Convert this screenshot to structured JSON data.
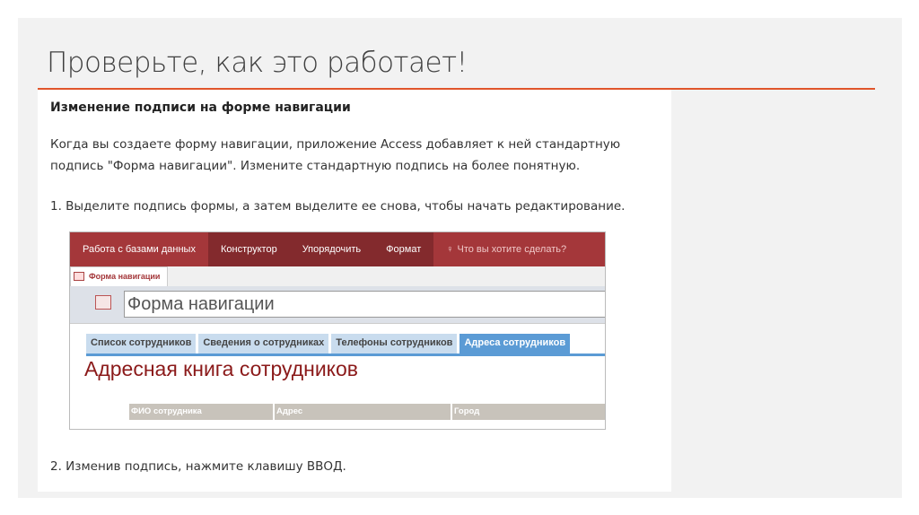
{
  "slide": {
    "title": "Проверьте, как это работает!"
  },
  "content": {
    "heading": "Изменение подписи на форме навигации",
    "paragraph": "Когда вы создаете форму навигации, приложение Access добавляет к ней стандартную подпись \"Форма навигации\". Измените стандартную подпись на более понятную.",
    "step1": "1.  Выделите подпись формы, а затем выделите ее снова, чтобы начать редактирование.",
    "step2": "2.  Изменив подпись, нажмите клавишу ВВОД."
  },
  "screenshot": {
    "ribbon": [
      "Работа с базами данных",
      "Конструктор",
      "Упорядочить",
      "Формат"
    ],
    "tell_me": "Что вы хотите сделать?",
    "doc_tab": "Форма навигации",
    "form_caption": "Форма навигации",
    "nav_tabs": [
      "Список сотрудников",
      "Сведения о сотрудниках",
      "Телефоны сотрудников",
      "Адреса сотрудников"
    ],
    "subform_title": "Адресная книга сотрудников",
    "columns": [
      "ФИО сотрудника",
      "Адрес",
      "Город"
    ]
  }
}
